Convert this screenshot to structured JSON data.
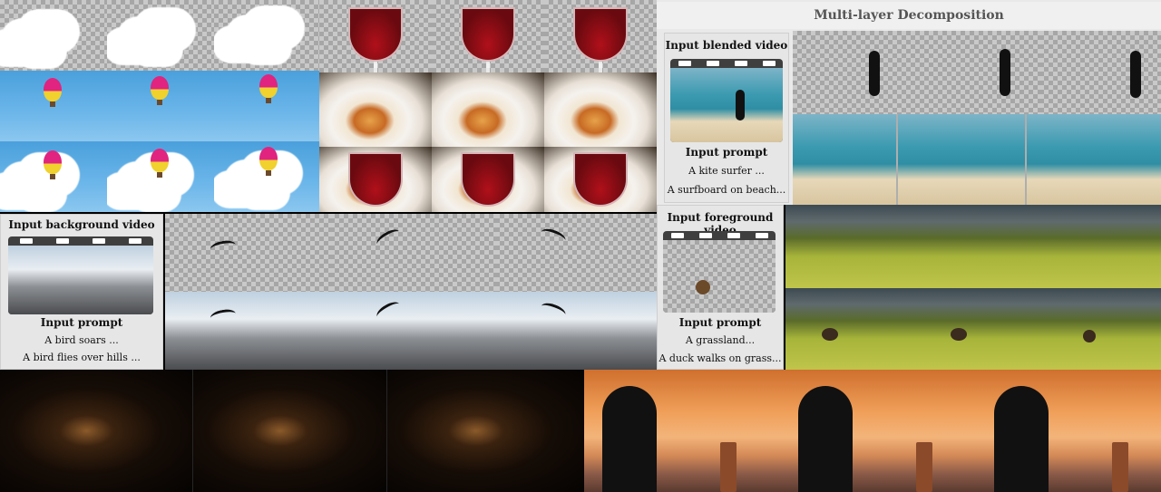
{
  "top_right": {
    "title": "Multi-layer Decomposition"
  },
  "blended_panel": {
    "title": "Input blended video",
    "prompt_label": "Input prompt",
    "prompt_1": "A kite surfer ...",
    "prompt_2": "A surfboard on beach..."
  },
  "background_panel": {
    "title": "Input background video",
    "prompt_label": "Input prompt",
    "prompt_1": "A bird soars ...",
    "prompt_2": "A bird flies over hills ..."
  },
  "foreground_panel": {
    "title": "Input foreground video",
    "prompt_label": "Input prompt",
    "prompt_1": "A grassland...",
    "prompt_2": "A duck walks on grass..."
  },
  "icons": [
    "film-strip-icon"
  ]
}
